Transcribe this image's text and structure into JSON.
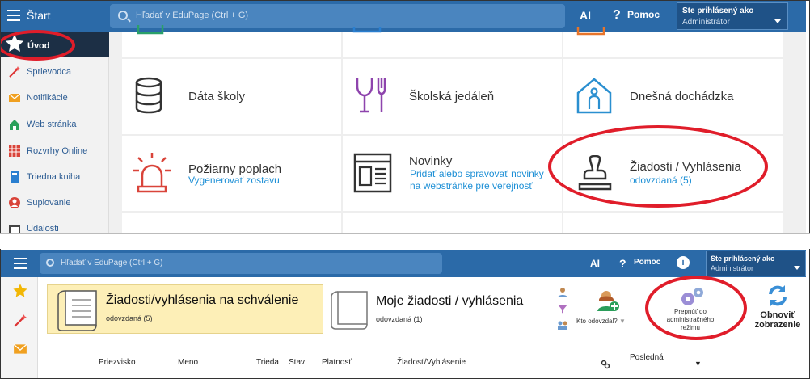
{
  "top": {
    "start_title": "Štart",
    "search_placeholder": "Hľadať v EduPage (Ctrl + G)",
    "ai_label": "AI",
    "help_label": "Pomoc",
    "account_line1": "Ste prihlásený ako",
    "account_line2": "Administrátor",
    "sidebar": [
      {
        "label": "Úvod",
        "icon": "star-icon"
      },
      {
        "label": "Sprievodca",
        "icon": "wand-icon"
      },
      {
        "label": "Notifikácie",
        "icon": "envelope-icon"
      },
      {
        "label": "Web stránka",
        "icon": "home-icon"
      },
      {
        "label": "Rozvrhy Online",
        "icon": "calendar-grid-icon"
      },
      {
        "label": "Triedna kniha",
        "icon": "book-icon"
      },
      {
        "label": "Suplovanie",
        "icon": "person-icon"
      },
      {
        "label": "Udalosti",
        "icon": "calendar-icon"
      }
    ],
    "tiles": [
      {
        "title": "Dáta školy",
        "icon": "database-icon"
      },
      {
        "title": "Školská jedáleň",
        "icon": "fork-glass-icon"
      },
      {
        "title": "Dnešná dochádzka",
        "icon": "house-person-icon"
      },
      {
        "title": "Požiarny poplach",
        "subtitle": "Vygenerovať zostavu",
        "icon": "alarm-icon"
      },
      {
        "title": "Novinky",
        "subtitle": "Pridať alebo spravovať novinky na webstránke pre verejnosť",
        "subtitle_lines": [
          "Pridať alebo spravovať novinky",
          "na webstránke pre verejnosť"
        ],
        "icon": "newspaper-icon"
      },
      {
        "title": "Žiadosti / Vyhlásenia",
        "subtitle": "odovzdaná (5)",
        "icon": "stamp-icon"
      }
    ]
  },
  "bottom": {
    "search_placeholder": "Hľadať v EduPage (Ctrl + G)",
    "ai_label": "AI",
    "help_label": "Pomoc",
    "info_label": "i",
    "account_line1": "Ste prihlásený ako",
    "account_line2": "Administrátor",
    "card_pending": {
      "title": "Žiadosti/vyhlásenia na schválenie",
      "subtitle": "odovzdaná (5)"
    },
    "card_mine": {
      "title": "Moje žiadosti / vyhlásenia",
      "subtitle": "odovzdaná (1)"
    },
    "kto_label": "Kto odovzdal?",
    "switch_admin": {
      "line1": "Prepnúť do",
      "line2": "administračného",
      "line3": "režimu"
    },
    "refresh": {
      "line1": "Obnoviť",
      "line2": "zobrazenie"
    },
    "table_headers": [
      "Priezvisko",
      "Meno",
      "Trieda",
      "Stav",
      "Platnosť",
      "Žiadosť/Vyhlásenie",
      "Posledná"
    ],
    "sort_arrow": "▼"
  },
  "colors": {
    "topbar": "#2b6aa8",
    "link": "#1e90d6",
    "highlight_card": "#fdefb7",
    "annotation_red": "#e01d2a"
  }
}
